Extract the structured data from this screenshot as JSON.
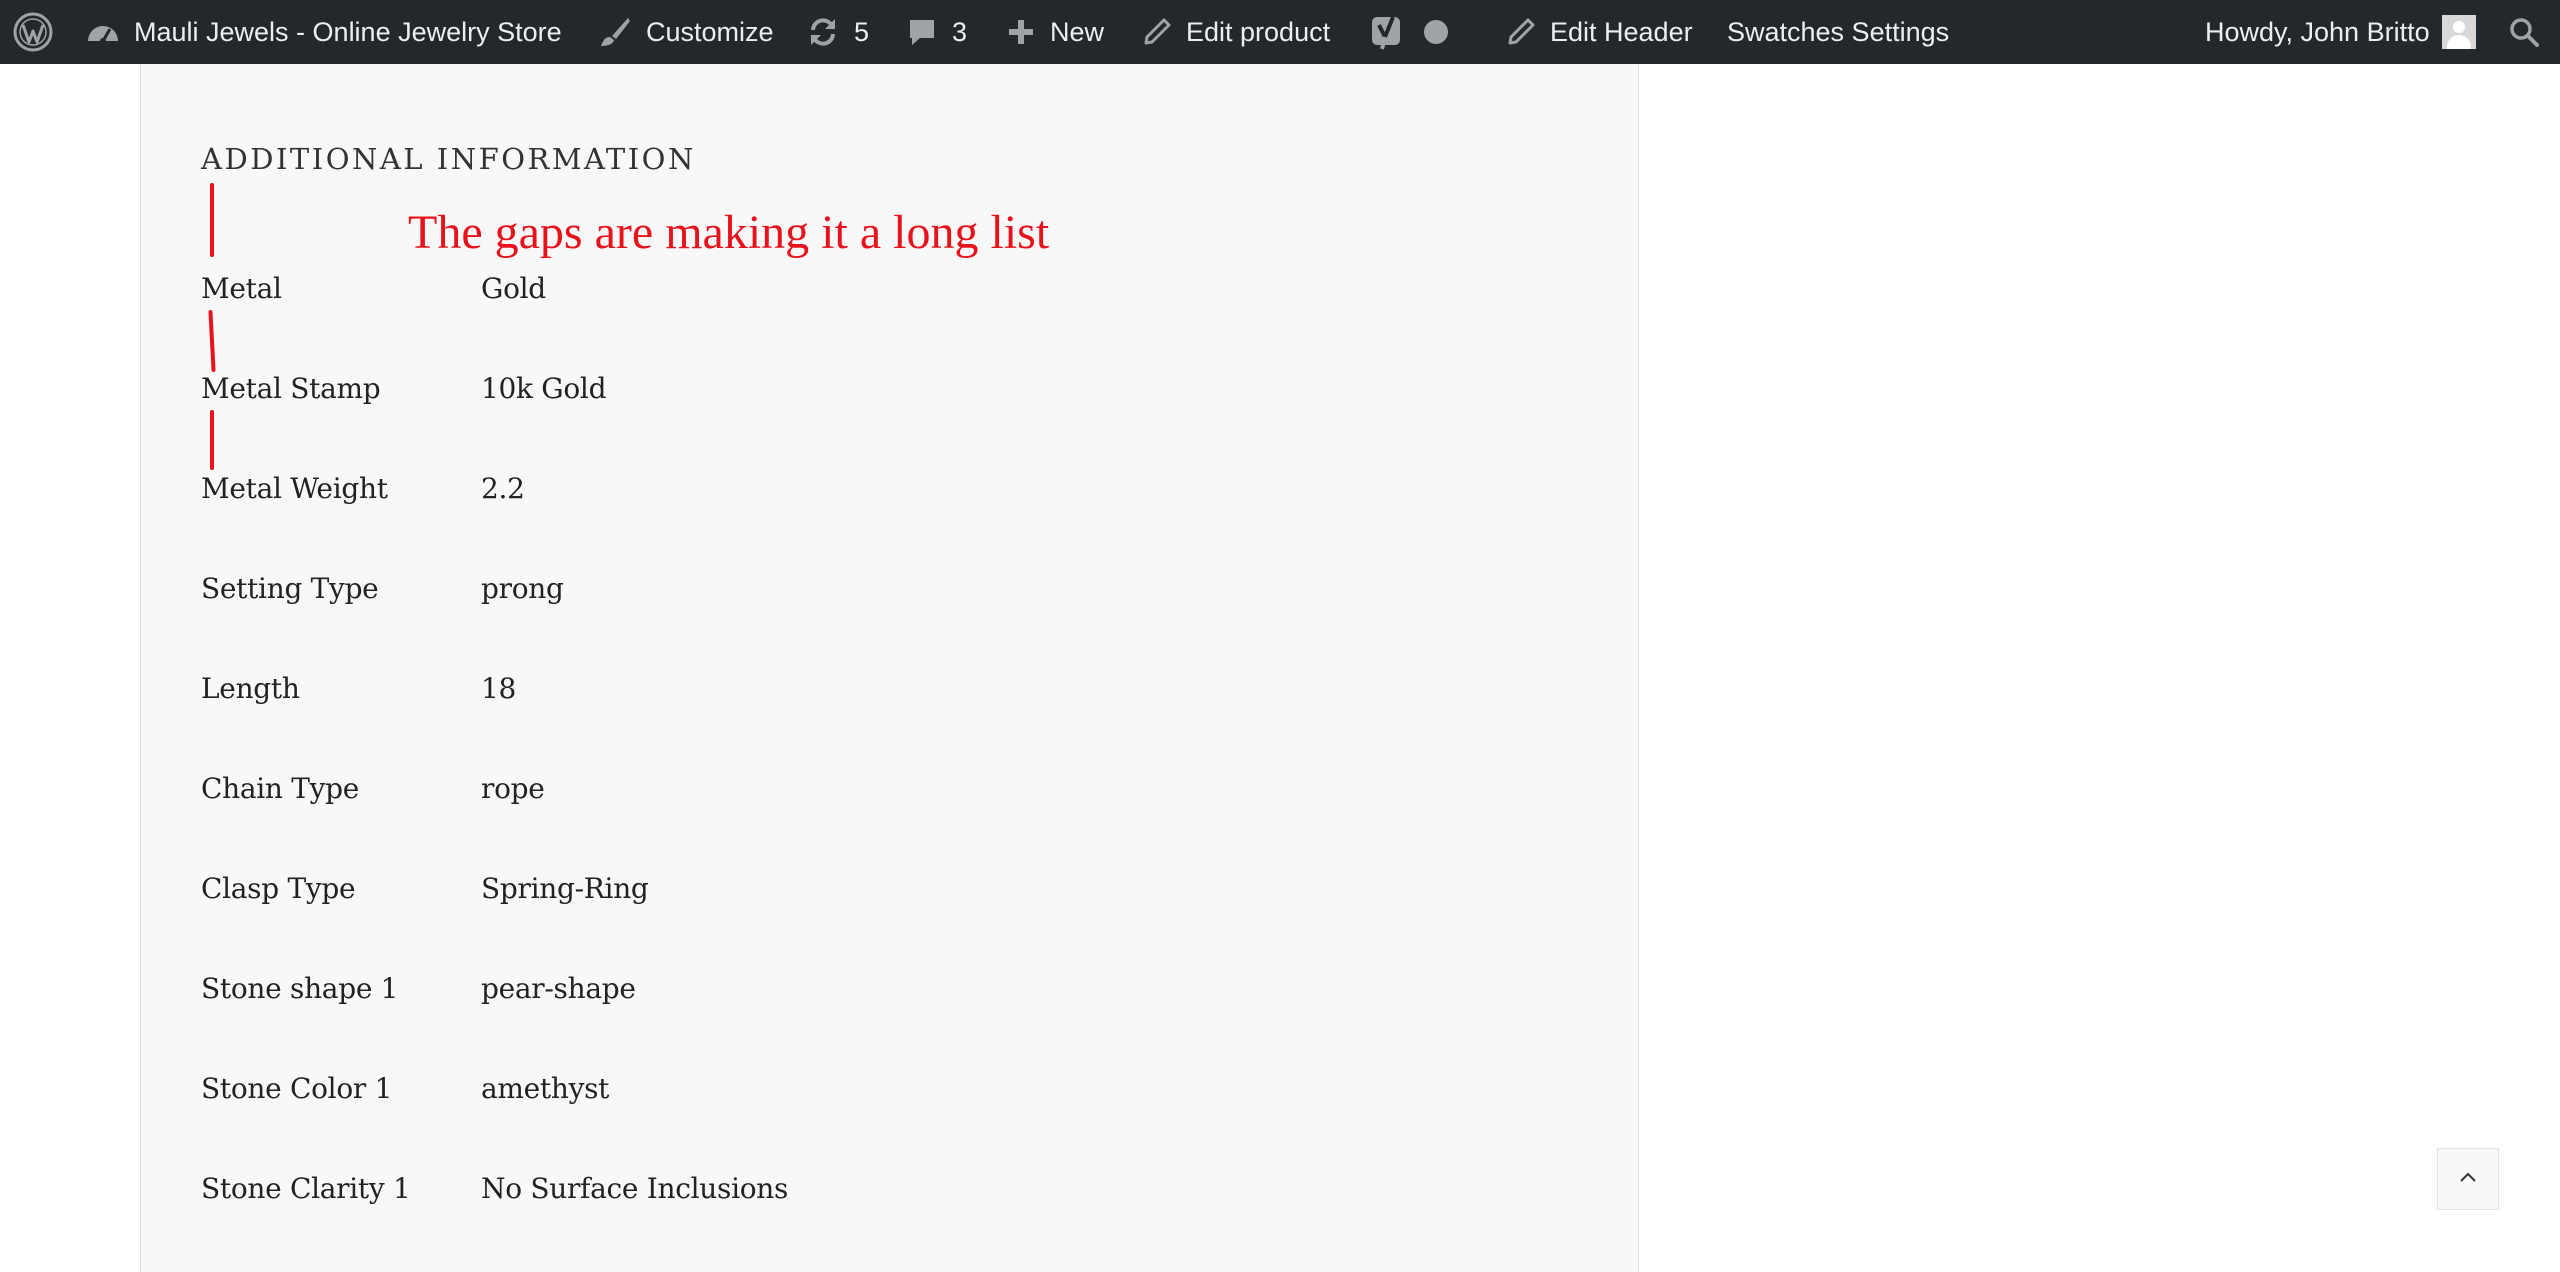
{
  "admin_bar": {
    "wp_logo_icon": "wordpress-icon",
    "site_name": "Mauli Jewels - Online Jewelry Store",
    "customize": "Customize",
    "updates_count": "5",
    "comments_count": "3",
    "new_label": "New",
    "edit_product": "Edit product",
    "edit_header": "Edit Header",
    "swatches_settings": "Swatches Settings",
    "howdy": "Howdy, John Britto"
  },
  "section": {
    "title": "ADDITIONAL INFORMATION"
  },
  "annotation": {
    "text": "The gaps are making it a long list",
    "color": "#e8121c"
  },
  "attributes": [
    {
      "label": "Metal",
      "value": "Gold"
    },
    {
      "label": "Metal Stamp",
      "value": "10k Gold"
    },
    {
      "label": "Metal Weight",
      "value": "2.2"
    },
    {
      "label": "Setting Type",
      "value": "prong"
    },
    {
      "label": "Length",
      "value": "18"
    },
    {
      "label": "Chain Type",
      "value": "rope"
    },
    {
      "label": "Clasp Type",
      "value": "Spring-Ring"
    },
    {
      "label": "Stone shape 1",
      "value": "pear-shape"
    },
    {
      "label": "Stone Color 1",
      "value": "amethyst"
    },
    {
      "label": "Stone Clarity 1",
      "value": "No Surface Inclusions"
    }
  ],
  "colors": {
    "admin_bar_bg": "#23282d",
    "panel_bg": "#f8f8f8",
    "annotation": "#e8121c"
  }
}
